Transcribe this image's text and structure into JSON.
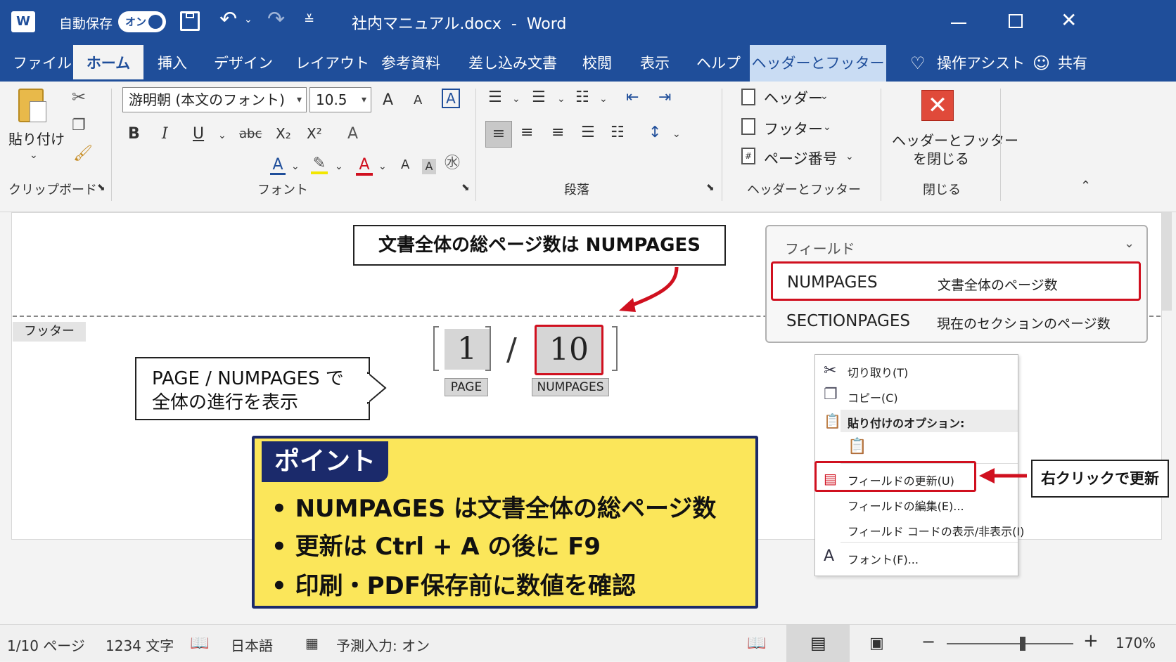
{
  "titlebar": {
    "word_icon": "W",
    "autosave_label": "自動保存",
    "autosave_toggle": "オン",
    "doc_title": "社内マニュアル.docx  -  Word",
    "icons": [
      "save-icon",
      "undo-icon",
      "redo-icon",
      "customize-icon",
      "restore-icon",
      "close-icon"
    ]
  },
  "tabs": [
    {
      "label": "ファイル"
    },
    {
      "label": "ホーム"
    },
    {
      "label": "挿入"
    },
    {
      "label": "デザイン"
    },
    {
      "label": "レイアウト"
    },
    {
      "label": "参考資料"
    },
    {
      "label": "差し込み文書"
    },
    {
      "label": "校閲"
    },
    {
      "label": "表示"
    },
    {
      "label": "ヘルプ"
    },
    {
      "label": "ヘッダーとフッター"
    }
  ],
  "tabs_right": {
    "assist": "操作アシスト",
    "share": "共有"
  },
  "ribbon": {
    "clipboard": {
      "paste": "貼り付け",
      "group": "クリップボード"
    },
    "font": {
      "name": "游明朝 (本文のフォント)",
      "size": "10.5",
      "group": "フォント",
      "bold": "B",
      "italic": "I",
      "underline": "U",
      "strike": "abc",
      "sub": "X₂",
      "sup": "X²",
      "grow": "A",
      "shrink": "A",
      "clear": "A",
      "color_a": "A",
      "shading": "A",
      "border_a": "A"
    },
    "paragraph": {
      "group": "段落"
    },
    "headerfooter": {
      "header": "ヘッダー",
      "footer": "フッター",
      "pagenum": "ページ番号",
      "group": "ヘッダーとフッター"
    },
    "close": {
      "label1": "ヘッダーとフッター",
      "label2": "を閉じる",
      "group": "閉じる"
    }
  },
  "document": {
    "footer_tag": "フッター",
    "page_field": "1",
    "slash": "/",
    "numpages_field": "10",
    "page_label": "PAGE",
    "numpages_label": "NUMPAGES",
    "callout_top": "文書全体の総ページ数は NUMPAGES",
    "callout_left_1": "PAGE / NUMPAGES で",
    "callout_left_2": "全体の進行を表示"
  },
  "point": {
    "title": "ポイント",
    "items": [
      "NUMPAGES は文書全体の総ページ数",
      "更新は Ctrl + A の後に F9",
      "印刷・PDF保存前に数値を確認"
    ]
  },
  "field_panel": {
    "title": "フィールド",
    "rows": [
      {
        "name": "NUMPAGES",
        "desc": "文書全体のページ数"
      },
      {
        "name": "SECTIONPAGES",
        "desc": "現在のセクションのページ数"
      }
    ]
  },
  "context_menu": {
    "cut": "切り取り(T)",
    "copy": "コピー(C)",
    "paste_opts": "貼り付けのオプション:",
    "update": "フィールドの更新(U)",
    "edit": "フィールドの編集(E)...",
    "toggle": "フィールド コードの表示/非表示(I)",
    "font": "フォント(F)...",
    "font_icon": "A"
  },
  "callout_right": "右クリックで更新",
  "statusbar": {
    "page": "1/10 ページ",
    "words": "1234 文字",
    "lang": "日本語",
    "predict": "予測入力: オン",
    "zoom": "170%",
    "minus": "−",
    "plus": "+",
    "zoom_level": 0.6
  },
  "colors": {
    "brand": "#1f4e9a",
    "accent_red": "#d0101f",
    "point_bg": "#fbe65a",
    "point_border": "#1b2a6b"
  }
}
